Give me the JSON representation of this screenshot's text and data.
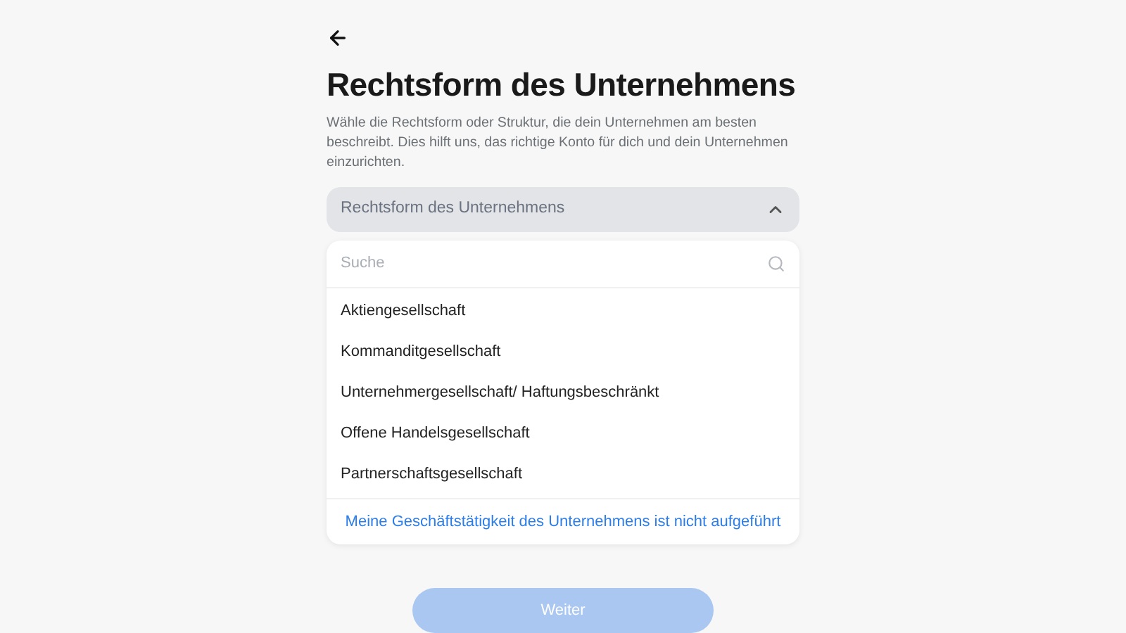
{
  "title": "Rechtsform des Unternehmens",
  "description": "Wähle die Rechtsform oder Struktur, die dein Unternehmen am besten beschreibt. Dies hilft uns, das richtige Konto für dich und dein Unternehmen einzurichten.",
  "select": {
    "placeholder": "Rechtsform des Unternehmens",
    "expanded": true
  },
  "search": {
    "placeholder": "Suche"
  },
  "options": [
    {
      "label": "Aktiengesellschaft",
      "selected": false
    },
    {
      "label": "Kommanditgesellschaft",
      "selected": false
    },
    {
      "label": "Unternehmergesellschaft/ Haftungsbeschränkt",
      "selected": false
    },
    {
      "label": "Offene Handelsgesellschaft",
      "selected": false
    },
    {
      "label": "Partnerschaftsgesellschaft",
      "selected": false
    }
  ],
  "footer_link": "Meine Geschäftstätigkeit des Unternehmens ist nicht aufgeführt",
  "continue_button": {
    "label": "Weiter",
    "disabled": true
  }
}
